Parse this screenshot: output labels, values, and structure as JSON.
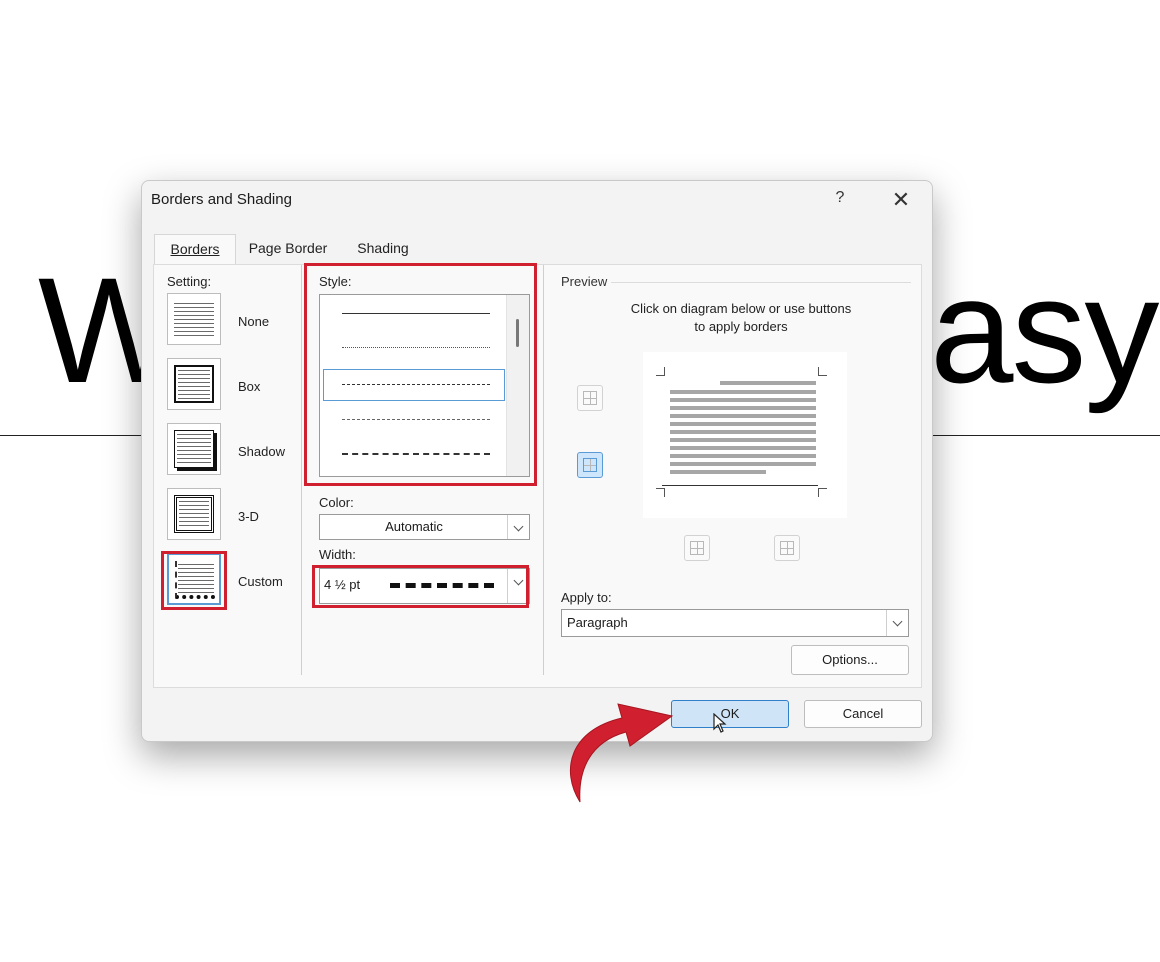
{
  "background": {
    "word_left": "W",
    "word_right": "asy"
  },
  "dialog": {
    "title": "Borders and Shading",
    "help": "?",
    "close": "✕",
    "tabs": [
      {
        "label": "Borders",
        "active": true
      },
      {
        "label": "Page Border",
        "active": false
      },
      {
        "label": "Shading",
        "active": false
      }
    ],
    "setting": {
      "label": "Setting:",
      "options": [
        "None",
        "Box",
        "Shadow",
        "3-D",
        "Custom"
      ],
      "selected": "Custom"
    },
    "style": {
      "label": "Style:",
      "selected": "dashed"
    },
    "color": {
      "label": "Color:",
      "value": "Automatic"
    },
    "width": {
      "label": "Width:",
      "value": "4 ½ pt"
    },
    "preview": {
      "label": "Preview",
      "instruction_line1": "Click on diagram below or use buttons",
      "instruction_line2": "to apply borders"
    },
    "apply_to": {
      "label": "Apply to:",
      "value": "Paragraph"
    },
    "options_button": "Options...",
    "ok_button": "OK",
    "cancel_button": "Cancel"
  },
  "colors": {
    "highlight": "#d0202f",
    "arrow": "#d0202f",
    "ok_bg": "#cfe4f7"
  }
}
